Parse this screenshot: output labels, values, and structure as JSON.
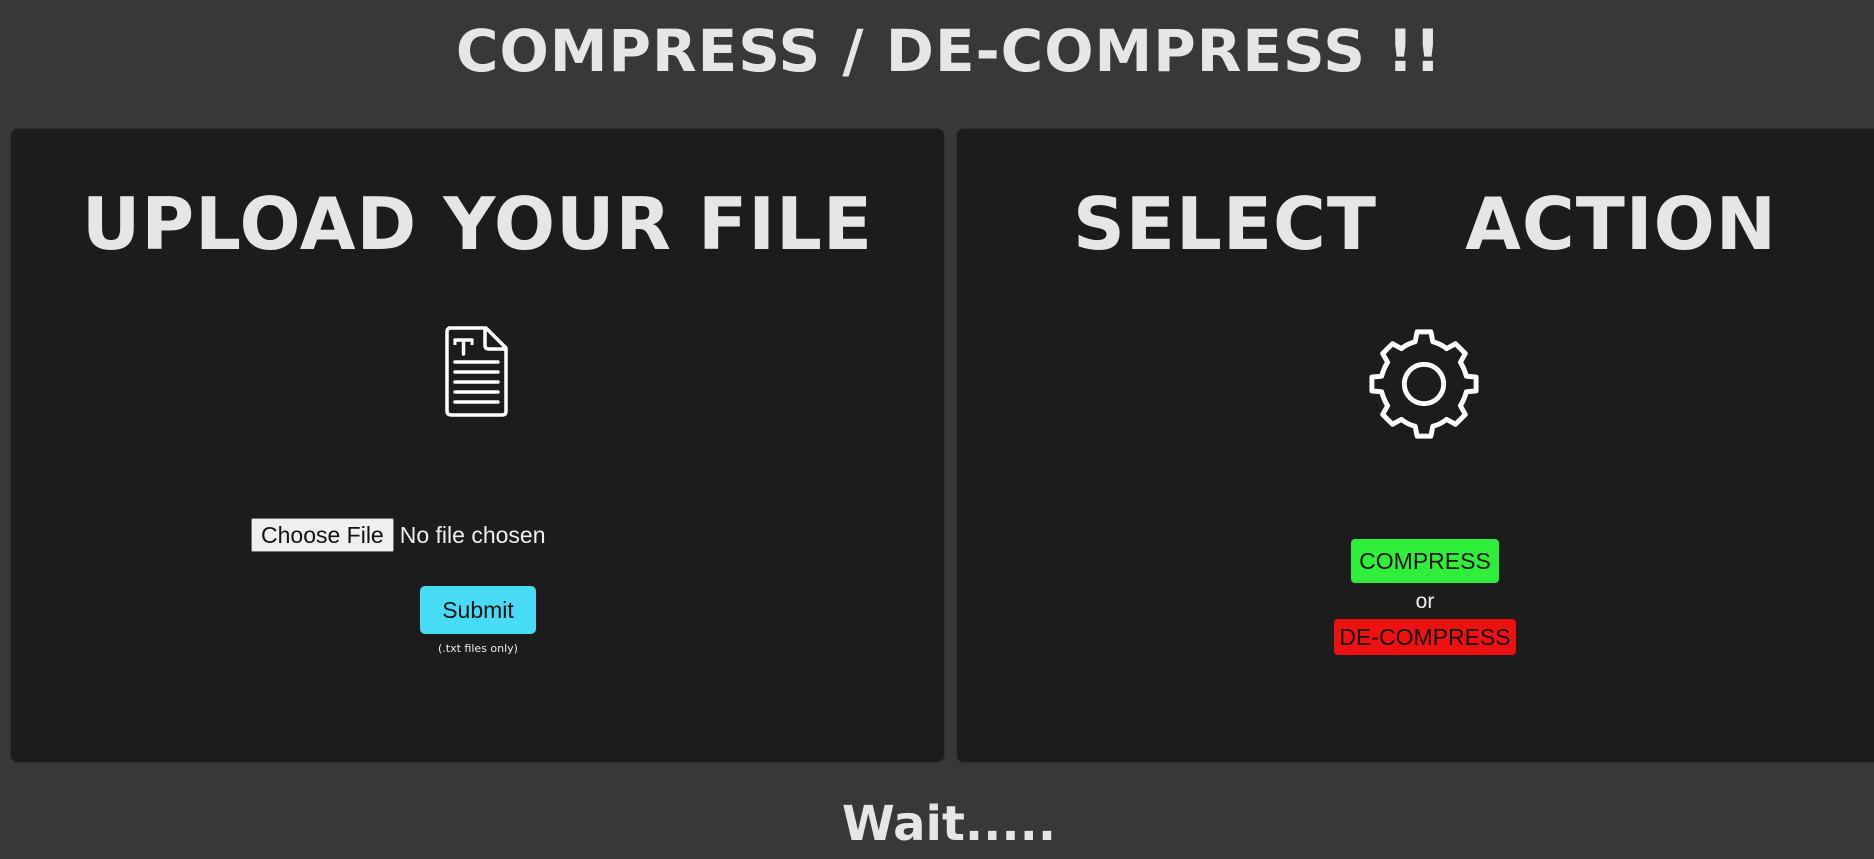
{
  "header": {
    "title": "COMPRESS / DE-COMPRESS !!"
  },
  "upload_panel": {
    "heading": "UPLOAD YOUR FILE",
    "icon": "text-file-icon",
    "choose_file_label": "Choose File",
    "file_status": "No file chosen",
    "submit_label": "Submit",
    "hint": "(.txt files only)"
  },
  "action_panel": {
    "heading": "SELECT  ACTION",
    "icon": "gear-icon",
    "compress_label": "COMPRESS",
    "separator": "or",
    "decompress_label": "DE-COMPRESS"
  },
  "status": {
    "text": "Wait....."
  },
  "colors": {
    "background": "#383838",
    "panel": "#1c1c1c",
    "submit": "#48dcf4",
    "compress": "#30ef3a",
    "decompress": "#ee1111"
  }
}
